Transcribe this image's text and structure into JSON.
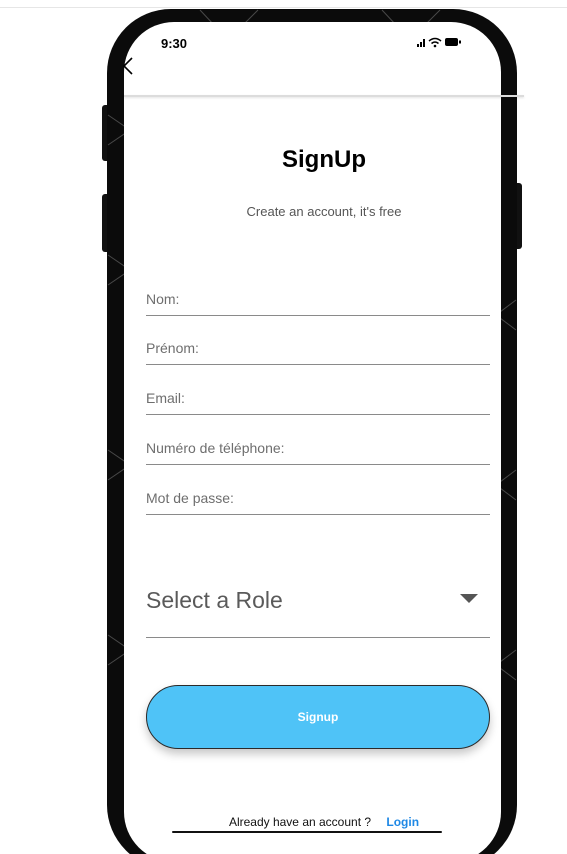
{
  "status_bar": {
    "time": "9:30",
    "icons": [
      "signal-icon",
      "wifi-icon",
      "battery-icon"
    ]
  },
  "app_bar": {
    "back_icon": "chevron-left-icon"
  },
  "header": {
    "title": "SignUp",
    "subtitle": "Create an account, it's free"
  },
  "form": {
    "fields": [
      {
        "placeholder": "Nom:",
        "value": ""
      },
      {
        "placeholder": "Prénom:",
        "value": ""
      },
      {
        "placeholder": "Email:",
        "value": ""
      },
      {
        "placeholder": "Numéro de téléphone:",
        "value": ""
      },
      {
        "placeholder": "Mot de passe:",
        "value": ""
      }
    ],
    "role_select": {
      "label": "Select a Role",
      "icon": "dropdown-arrow-icon"
    },
    "submit_label": "Signup"
  },
  "footer": {
    "prompt": "Already have an account ?",
    "login_label": "Login"
  },
  "colors": {
    "accent": "#4fc3f7",
    "link": "#1e88e5",
    "frame": "#0b0b0b"
  }
}
